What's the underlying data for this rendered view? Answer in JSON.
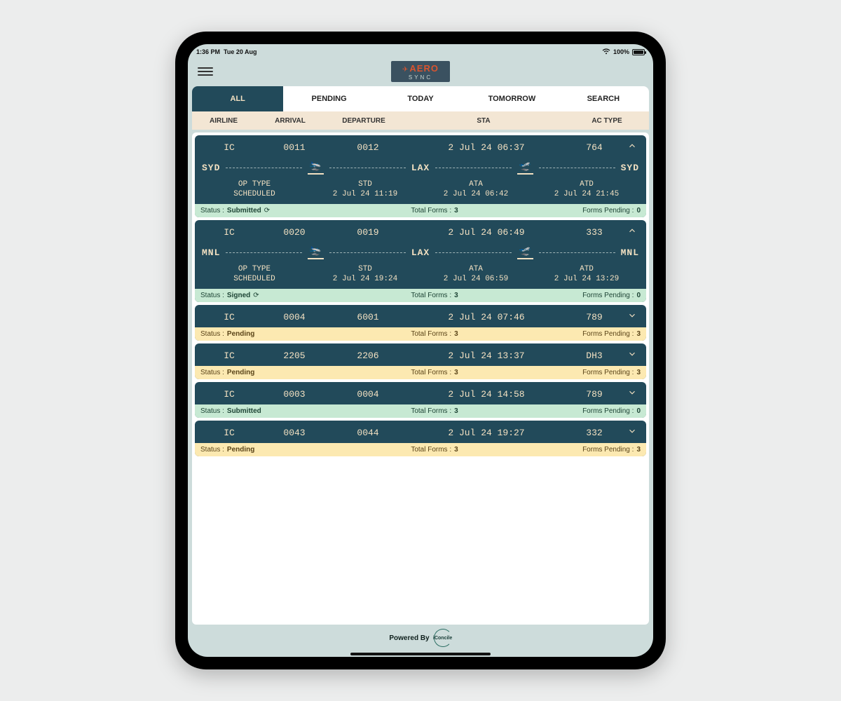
{
  "statusbar": {
    "time": "1:36 PM",
    "date": "Tue 20 Aug",
    "battery": "100%"
  },
  "logo": {
    "line1": "AERO",
    "line2": "SYNC"
  },
  "tabs": [
    "ALL",
    "PENDING",
    "TODAY",
    "TOMORROW",
    "SEARCH"
  ],
  "activeTab": 0,
  "columns": {
    "airline": "AIRLINE",
    "arrival": "ARRIVAL",
    "departure": "DEPARTURE",
    "sta": "STA",
    "ac": "AC TYPE"
  },
  "labels": {
    "status": "Status :",
    "totalForms": "Total Forms :",
    "formsPending": "Forms Pending :",
    "opType": "OP TYPE",
    "std": "STD",
    "ata": "ATA",
    "atd": "ATD",
    "poweredBy": "Powered By",
    "footerBrand": "iConcile"
  },
  "flights": [
    {
      "airline": "IC",
      "arr": "0011",
      "dep": "0012",
      "sta": "2 Jul 24 06:37",
      "ac": "764",
      "expanded": true,
      "route": {
        "from": "SYD",
        "via": "LAX",
        "to": "SYD"
      },
      "opType": "SCHEDULED",
      "std": "2 Jul 24 11:19",
      "ata": "2 Jul 24 06:42",
      "atd": "2 Jul 24 21:45",
      "status": "Submitted",
      "statusColor": "green",
      "refresh": true,
      "totalForms": "3",
      "formsPending": "0"
    },
    {
      "airline": "IC",
      "arr": "0020",
      "dep": "0019",
      "sta": "2 Jul 24 06:49",
      "ac": "333",
      "expanded": true,
      "route": {
        "from": "MNL",
        "via": "LAX",
        "to": "MNL"
      },
      "opType": "SCHEDULED",
      "std": "2 Jul 24 19:24",
      "ata": "2 Jul 24 06:59",
      "atd": "2 Jul 24 13:29",
      "status": "Signed",
      "statusColor": "green",
      "refresh": true,
      "totalForms": "3",
      "formsPending": "0"
    },
    {
      "airline": "IC",
      "arr": "0004",
      "dep": "6001",
      "sta": "2 Jul 24 07:46",
      "ac": "789",
      "expanded": false,
      "status": "Pending",
      "statusColor": "yellow",
      "refresh": false,
      "totalForms": "3",
      "formsPending": "3"
    },
    {
      "airline": "IC",
      "arr": "2205",
      "dep": "2206",
      "sta": "2 Jul 24 13:37",
      "ac": "DH3",
      "expanded": false,
      "status": "Pending",
      "statusColor": "yellow",
      "refresh": false,
      "totalForms": "3",
      "formsPending": "3"
    },
    {
      "airline": "IC",
      "arr": "0003",
      "dep": "0004",
      "sta": "2 Jul 24 14:58",
      "ac": "789",
      "expanded": false,
      "status": "Submitted",
      "statusColor": "green",
      "refresh": false,
      "totalForms": "3",
      "formsPending": "0"
    },
    {
      "airline": "IC",
      "arr": "0043",
      "dep": "0044",
      "sta": "2 Jul 24 19:27",
      "ac": "332",
      "expanded": false,
      "status": "Pending",
      "statusColor": "yellow",
      "refresh": false,
      "totalForms": "3",
      "formsPending": "3"
    }
  ]
}
